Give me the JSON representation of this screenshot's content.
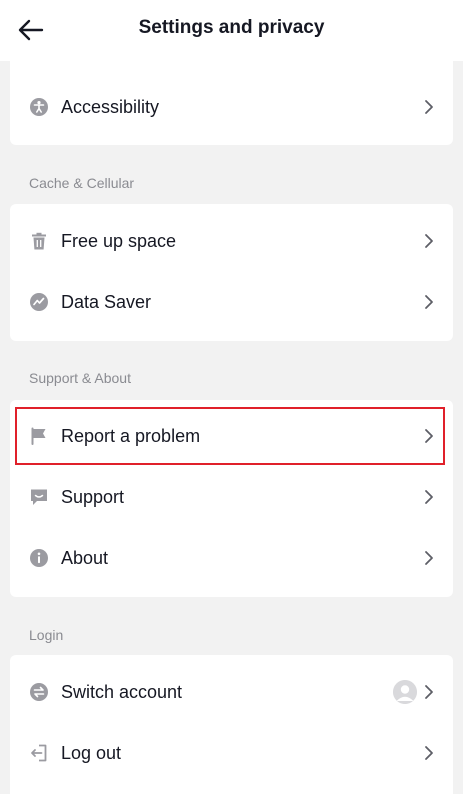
{
  "header": {
    "title": "Settings and privacy",
    "back_icon": "arrow-left-icon"
  },
  "sections": {
    "top": {
      "items": [
        {
          "label": "Accessibility",
          "icon": "accessibility-icon"
        }
      ]
    },
    "cache": {
      "title": "Cache & Cellular",
      "items": [
        {
          "label": "Free up space",
          "icon": "trash-icon"
        },
        {
          "label": "Data Saver",
          "icon": "data-saver-icon"
        }
      ]
    },
    "support": {
      "title": "Support & About",
      "items": [
        {
          "label": "Report a problem",
          "icon": "flag-icon",
          "highlighted": true
        },
        {
          "label": "Support",
          "icon": "chat-icon"
        },
        {
          "label": "About",
          "icon": "info-icon"
        }
      ]
    },
    "login": {
      "title": "Login",
      "items": [
        {
          "label": "Switch account",
          "icon": "switch-icon",
          "has_avatar": true
        },
        {
          "label": "Log out",
          "icon": "logout-icon"
        }
      ]
    }
  },
  "colors": {
    "background": "#f2f2f2",
    "card": "#ffffff",
    "text": "#161823",
    "muted": "#8a8b91",
    "icon": "#9b9ba1",
    "highlight": "#e0202a"
  }
}
